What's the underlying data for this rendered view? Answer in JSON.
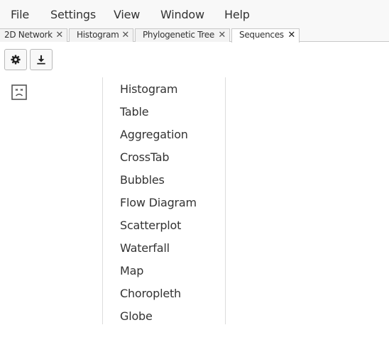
{
  "menubar": {
    "items": [
      "File",
      "Settings",
      "View",
      "Window",
      "Help"
    ]
  },
  "tabs": [
    {
      "label": "2D Network",
      "close": "✕",
      "active": false
    },
    {
      "label": "Histogram",
      "close": "✕",
      "active": false
    },
    {
      "label": "Phylogenetic Tree",
      "close": "✕",
      "active": false
    },
    {
      "label": "Sequences",
      "close": "✕",
      "active": true
    }
  ],
  "toolbar": {
    "settings_icon": "gear-icon",
    "download_icon": "download-icon"
  },
  "status_icon": "sad-face-icon",
  "dropdown": {
    "items": [
      "Histogram",
      "Table",
      "Aggregation",
      "CrossTab",
      "Bubbles",
      "Flow Diagram",
      "Scatterplot",
      "Waterfall",
      "Map",
      "Choropleth",
      "Globe"
    ]
  },
  "colors": {
    "menubar_bg": "#f8f8f8",
    "tab_border": "#c8c8c8",
    "text": "#333333"
  }
}
